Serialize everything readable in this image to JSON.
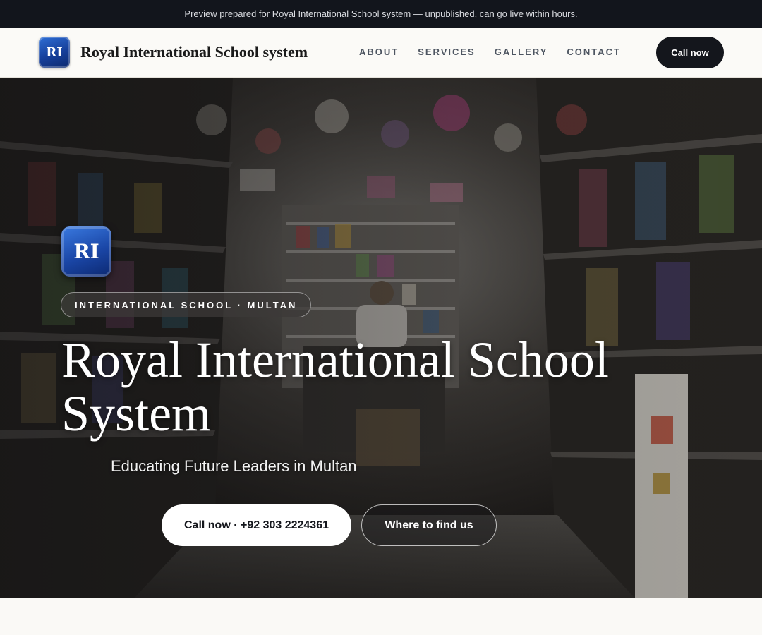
{
  "banner": {
    "text": "Preview prepared for Royal International School system — unpublished, can go live within hours."
  },
  "header": {
    "logo_initials": "RI",
    "brand_name": "Royal International School system",
    "nav": {
      "about": "ABOUT",
      "services": "SERVICES",
      "gallery": "GALLERY",
      "contact": "CONTACT"
    },
    "cta_label": "Call now"
  },
  "hero": {
    "logo_initials": "RI",
    "tag": "INTERNATIONAL SCHOOL · MULTAN",
    "title": "Royal International School System",
    "subtitle": "Educating Future Leaders in Multan",
    "primary_button": "Call now · +92 303 2224361",
    "secondary_button": "Where to find us",
    "background_image": "shop-interior-photo"
  },
  "colors": {
    "banner_bg": "#12151c",
    "header_bg": "#fbfaf7",
    "dark_button": "#14161c",
    "logo_blue": "#163f9a",
    "nav_text": "#4d5561"
  }
}
